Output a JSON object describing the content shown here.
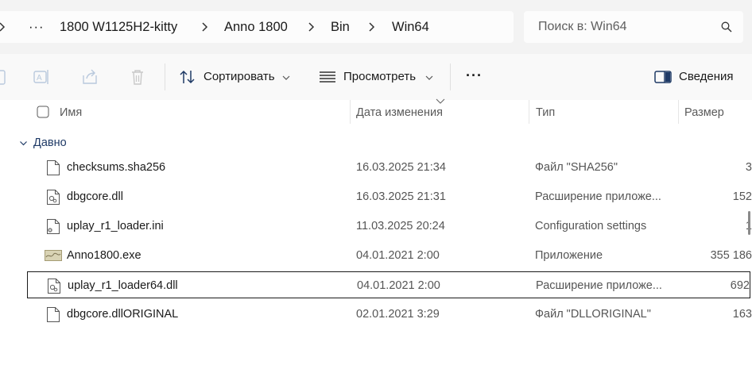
{
  "breadcrumb": {
    "overflow": "···",
    "items": [
      "1800 W1125H2-kitty",
      "Anno 1800",
      "Bin",
      "Win64"
    ]
  },
  "search": {
    "placeholder": "Поиск в: Win64",
    "icon": "search-icon"
  },
  "toolbar": {
    "sort_label": "Сортировать",
    "view_label": "Просмотреть",
    "more_label": "···",
    "details_label": "Сведения"
  },
  "columns": {
    "name": "Имя",
    "date": "Дата изменения",
    "type": "Тип",
    "size": "Размер"
  },
  "group": {
    "label": "Давно"
  },
  "files": [
    {
      "name": "checksums.sha256",
      "date": "16.03.2025 21:34",
      "type": "Файл \"SHA256\"",
      "size": "3",
      "icon": "generic-file-icon"
    },
    {
      "name": "dbgcore.dll",
      "date": "16.03.2025 21:31",
      "type": "Расширение приложе...",
      "size": "152",
      "icon": "dll-file-icon"
    },
    {
      "name": "uplay_r1_loader.ini",
      "date": "11.03.2025 20:24",
      "type": "Configuration settings",
      "size": "1",
      "icon": "ini-file-icon"
    },
    {
      "name": "Anno1800.exe",
      "date": "04.01.2021 2:00",
      "type": "Приложение",
      "size": "355 186",
      "icon": "exe-file-icon"
    },
    {
      "name": "uplay_r1_loader64.dll",
      "date": "04.01.2021 2:00",
      "type": "Расширение приложе...",
      "size": "692",
      "icon": "dll-file-icon"
    },
    {
      "name": "dbgcore.dllORIGINAL",
      "date": "02.01.2021 3:29",
      "type": "Файл \"DLLORIGINAL\"",
      "size": "163",
      "icon": "generic-file-icon"
    }
  ],
  "selected_index": 4,
  "colors": {
    "group_text": "#1f3a66",
    "selection_border": "#1a1a1a",
    "toolbar_bg": "#f9f9f9",
    "address_bg": "#f3f3f3"
  }
}
